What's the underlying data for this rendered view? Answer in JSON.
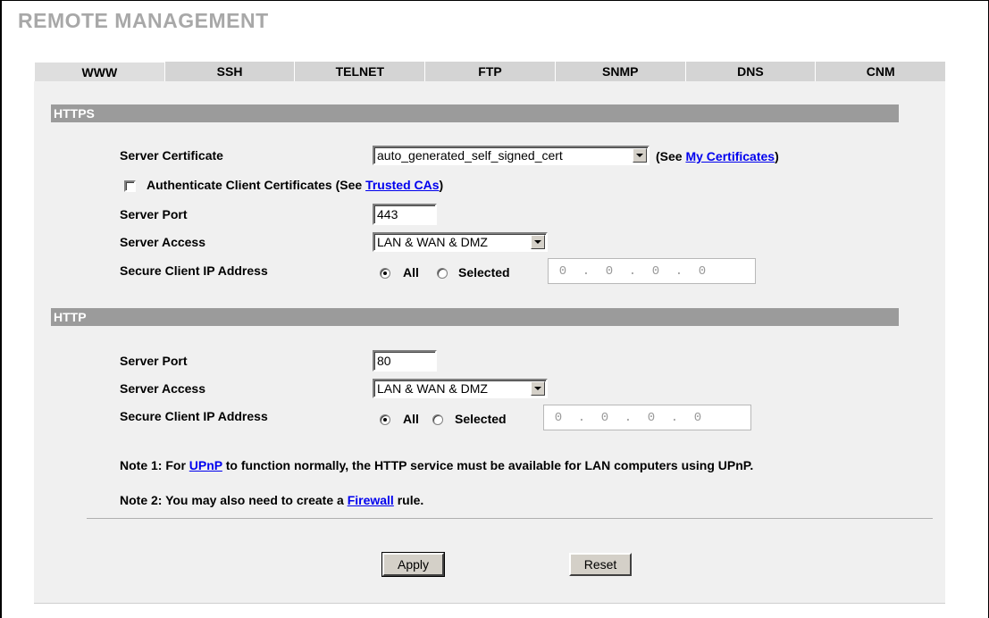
{
  "page_title": "REMOTE MANAGEMENT",
  "tabs": [
    "WWW",
    "SSH",
    "TELNET",
    "FTP",
    "SNMP",
    "DNS",
    "CNM"
  ],
  "active_tab": "WWW",
  "https": {
    "section_title": "HTTPS",
    "server_certificate_label": "Server Certificate",
    "server_certificate_value": "auto_generated_self_signed_cert",
    "see_prefix": "(See ",
    "my_certificates_link": "My Certificates",
    "see_suffix": ")",
    "auth_client_label": "Authenticate Client Certificates (See ",
    "trusted_cas_link": "Trusted CAs",
    "auth_client_suffix": ")",
    "server_port_label": "Server Port",
    "server_port_value": "443",
    "server_access_label": "Server Access",
    "server_access_value": "LAN & WAN & DMZ",
    "secure_ip_label": "Secure Client IP Address",
    "radio_all": "All",
    "radio_selected": "Selected",
    "ip": [
      "0",
      "0",
      "0",
      "0"
    ]
  },
  "http": {
    "section_title": "HTTP",
    "server_port_label": "Server Port",
    "server_port_value": "80",
    "server_access_label": "Server Access",
    "server_access_value": "LAN & WAN & DMZ",
    "secure_ip_label": "Secure Client IP Address",
    "radio_all": "All",
    "radio_selected": "Selected",
    "ip": [
      "0",
      "0",
      "0",
      "0"
    ]
  },
  "notes": {
    "note1_prefix": "Note 1: For ",
    "upnp_link": "UPnP",
    "note1_suffix": " to function normally, the HTTP service must be available for LAN computers using UPnP.",
    "note2_prefix": "Note 2: You may also need to create a ",
    "firewall_link": "Firewall",
    "note2_suffix": " rule."
  },
  "buttons": {
    "apply": "Apply",
    "reset": "Reset"
  }
}
